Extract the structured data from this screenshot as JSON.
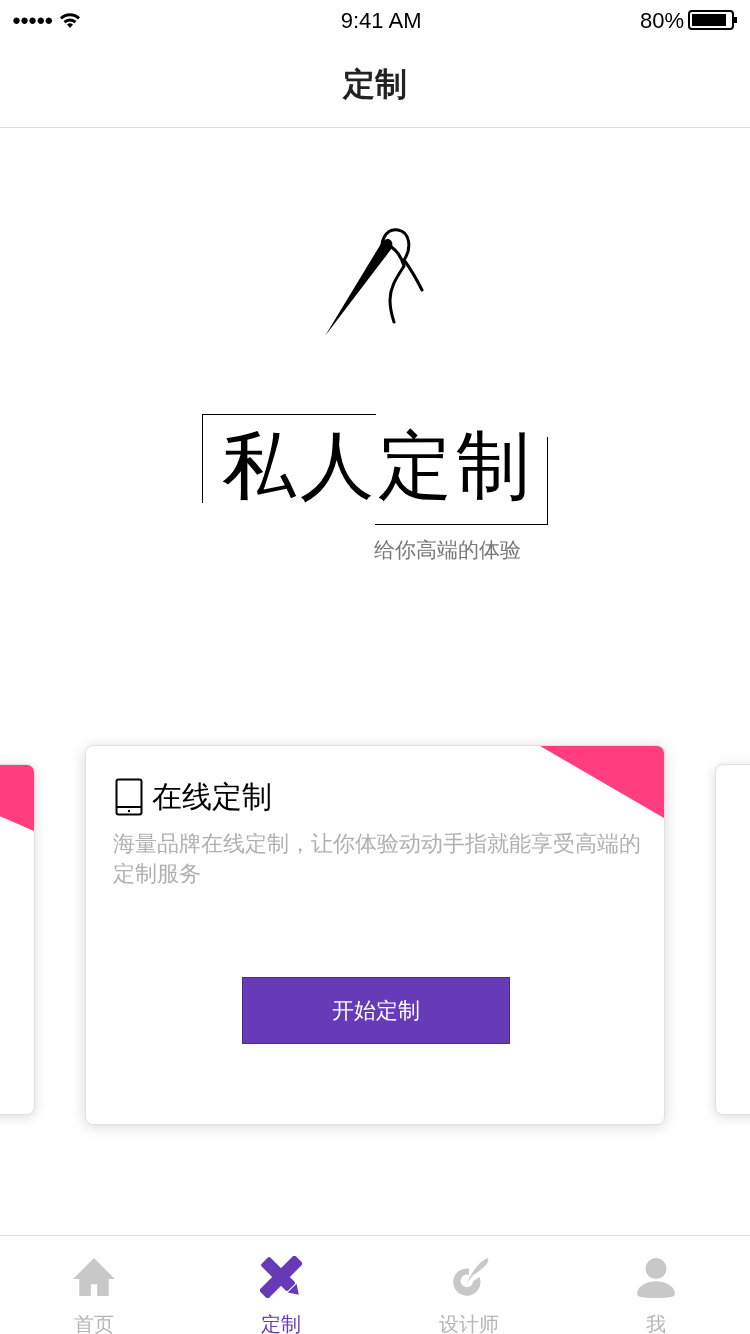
{
  "status_bar": {
    "signal": "●●●●●",
    "time": "9:41 AM",
    "battery_percent": "80%"
  },
  "nav": {
    "title": "定制"
  },
  "hero": {
    "title": "私人定制",
    "subtitle": "给你高端的体验"
  },
  "card": {
    "title": "在线定制",
    "description": "海量品牌在线定制，让你体验动动手指就能享受高端的定制服务",
    "button": "开始定制"
  },
  "tabs": [
    {
      "label": "首页",
      "kind": "home",
      "selected": false
    },
    {
      "label": "定制",
      "kind": "custom",
      "selected": true
    },
    {
      "label": "设计师",
      "kind": "designer",
      "selected": false
    },
    {
      "label": "我",
      "kind": "me",
      "selected": false
    }
  ]
}
